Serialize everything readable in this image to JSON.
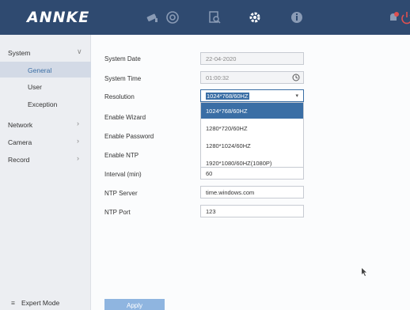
{
  "header": {
    "logo": "ANNKE",
    "icons": [
      "camera-icon",
      "playback-icon",
      "search-files-icon",
      "settings-icon",
      "info-icon",
      "alert-icon",
      "power-icon"
    ]
  },
  "sidebar": {
    "items": [
      {
        "label": "System",
        "expanded": true,
        "sub": [
          {
            "label": "General",
            "active": true
          },
          {
            "label": "User"
          },
          {
            "label": "Exception"
          }
        ]
      },
      {
        "label": "Network"
      },
      {
        "label": "Camera"
      },
      {
        "label": "Record"
      }
    ],
    "expert_mode": "Expert Mode"
  },
  "form": {
    "system_date": {
      "label": "System Date",
      "value": "22-04-2020"
    },
    "system_time": {
      "label": "System Time",
      "value": "01:00:32"
    },
    "resolution": {
      "label": "Resolution",
      "value": "1024*768/60HZ"
    },
    "enable_wizard": {
      "label": "Enable Wizard"
    },
    "enable_password": {
      "label": "Enable Password"
    },
    "enable_ntp": {
      "label": "Enable NTP"
    },
    "interval": {
      "label": "Interval (min)",
      "value": "60"
    },
    "ntp_server": {
      "label": "NTP Server",
      "value": "time.windows.com"
    },
    "ntp_port": {
      "label": "NTP Port",
      "value": "123"
    }
  },
  "resolution_options": [
    "1024*768/60HZ",
    "1280*720/60HZ",
    "1280*1024/60HZ",
    "1920*1080/60HZ(1080P)"
  ],
  "apply_label": "Apply",
  "colors": {
    "header": "#2f4a70",
    "accent": "#3a6ea5",
    "alert": "#e05050"
  }
}
